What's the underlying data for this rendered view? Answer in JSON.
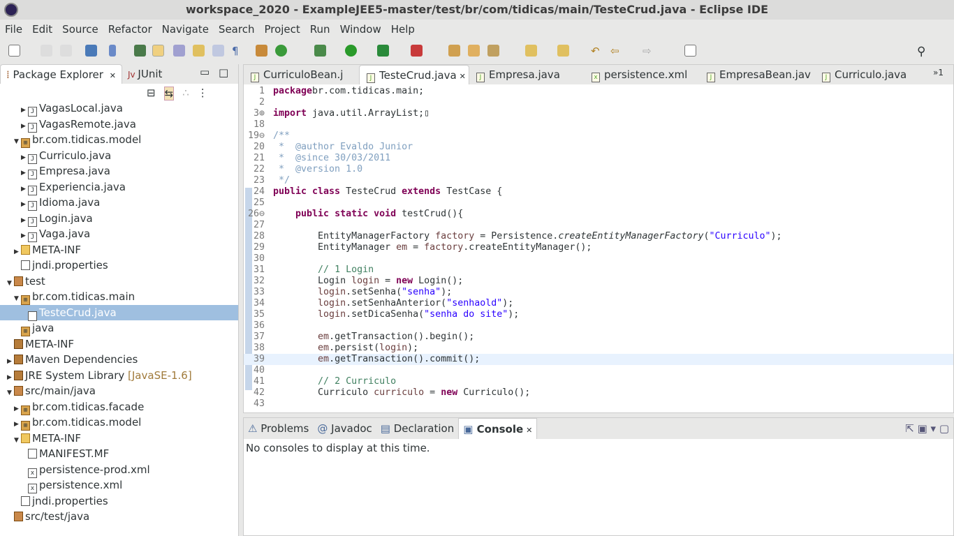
{
  "window": {
    "title": "workspace_2020 - ExampleJEE5-master/test/br/com/tidicas/main/TesteCrud.java - Eclipse IDE"
  },
  "menu": [
    "File",
    "Edit",
    "Source",
    "Refactor",
    "Navigate",
    "Search",
    "Project",
    "Run",
    "Window",
    "Help"
  ],
  "left_panel": {
    "tabs": [
      {
        "label": "Package Explorer",
        "active": true,
        "closable": true
      },
      {
        "label": "JUnit",
        "active": false
      }
    ],
    "tree": [
      {
        "label": "VagasLocal.java",
        "depth": 3,
        "type": "java",
        "arrow": "right"
      },
      {
        "label": "VagasRemote.java",
        "depth": 3,
        "type": "java",
        "arrow": "right"
      },
      {
        "label": "br.com.tidicas.model",
        "depth": 2,
        "type": "pkg",
        "arrow": "down"
      },
      {
        "label": "Curriculo.java",
        "depth": 3,
        "type": "java",
        "arrow": "right"
      },
      {
        "label": "Empresa.java",
        "depth": 3,
        "type": "java",
        "arrow": "right"
      },
      {
        "label": "Experiencia.java",
        "depth": 3,
        "type": "java",
        "arrow": "right"
      },
      {
        "label": "Idioma.java",
        "depth": 3,
        "type": "java",
        "arrow": "right"
      },
      {
        "label": "Login.java",
        "depth": 3,
        "type": "java",
        "arrow": "right"
      },
      {
        "label": "Vaga.java",
        "depth": 3,
        "type": "java",
        "arrow": "right"
      },
      {
        "label": "META-INF",
        "depth": 2,
        "type": "folder",
        "arrow": "right"
      },
      {
        "label": "jndi.properties",
        "depth": 2,
        "type": "file",
        "arrow": ""
      },
      {
        "label": "test",
        "depth": 1,
        "type": "src",
        "arrow": "down"
      },
      {
        "label": "br.com.tidicas.main",
        "depth": 2,
        "type": "pkg",
        "arrow": "down"
      },
      {
        "label": "TesteCrud.java",
        "depth": 3,
        "type": "java",
        "arrow": "",
        "selected": true
      },
      {
        "label": "java",
        "depth": 2,
        "type": "pkg",
        "arrow": ""
      },
      {
        "label": "META-INF",
        "depth": 1,
        "type": "lib",
        "arrow": ""
      },
      {
        "label": "Maven Dependencies",
        "depth": 1,
        "type": "lib",
        "arrow": "right"
      },
      {
        "label": "JRE System Library",
        "depth": 1,
        "type": "lib",
        "arrow": "right",
        "decoration": "[JavaSE-1.6]"
      },
      {
        "label": "src/main/java",
        "depth": 1,
        "type": "src",
        "arrow": "down"
      },
      {
        "label": "br.com.tidicas.facade",
        "depth": 2,
        "type": "pkg",
        "arrow": "right"
      },
      {
        "label": "br.com.tidicas.model",
        "depth": 2,
        "type": "pkg",
        "arrow": "right"
      },
      {
        "label": "META-INF",
        "depth": 2,
        "type": "folder",
        "arrow": "down"
      },
      {
        "label": "MANIFEST.MF",
        "depth": 3,
        "type": "file",
        "arrow": ""
      },
      {
        "label": "persistence-prod.xml",
        "depth": 3,
        "type": "xml",
        "arrow": ""
      },
      {
        "label": "persistence.xml",
        "depth": 3,
        "type": "xml",
        "arrow": ""
      },
      {
        "label": "jndi.properties",
        "depth": 2,
        "type": "file",
        "arrow": ""
      },
      {
        "label": "src/test/java",
        "depth": 1,
        "type": "src",
        "arrow": ""
      }
    ]
  },
  "editor": {
    "tabs": [
      {
        "label": "CurriculoBean.j",
        "active": false
      },
      {
        "label": "TesteCrud.java",
        "active": true,
        "closable": true
      },
      {
        "label": "Empresa.java",
        "active": false
      },
      {
        "label": "persistence.xml",
        "active": false
      },
      {
        "label": "EmpresaBean.jav",
        "active": false
      },
      {
        "label": "Curriculo.java",
        "active": false
      }
    ],
    "overflow": "»1",
    "lines": [
      {
        "n": "1",
        "t": [
          [
            "kw",
            "package"
          ],
          [
            "",
            "br.com.tidicas.main;"
          ]
        ]
      },
      {
        "n": "2",
        "t": []
      },
      {
        "n": "3⊕",
        "t": [
          [
            "kw",
            "import"
          ],
          [
            "",
            " java.util.ArrayList;▯"
          ]
        ]
      },
      {
        "n": "18",
        "t": []
      },
      {
        "n": "19⊖",
        "t": [
          [
            "doc",
            "/**"
          ]
        ]
      },
      {
        "n": "20",
        "t": [
          [
            "doc",
            " *  @author Evaldo Junior"
          ]
        ]
      },
      {
        "n": "21",
        "t": [
          [
            "doc",
            " *  @since 30/03/2011"
          ]
        ]
      },
      {
        "n": "22",
        "t": [
          [
            "doc",
            " *  @version 1.0"
          ]
        ]
      },
      {
        "n": "23",
        "t": [
          [
            "doc",
            " */"
          ]
        ]
      },
      {
        "n": "24",
        "t": [
          [
            "kw",
            "public class"
          ],
          [
            "",
            " TesteCrud "
          ],
          [
            "kw",
            "extends"
          ],
          [
            "",
            " TestCase {"
          ]
        ]
      },
      {
        "n": "25",
        "t": []
      },
      {
        "n": "26⊖",
        "t": [
          [
            "",
            "    "
          ],
          [
            "kw",
            "public static void"
          ],
          [
            "",
            " testCrud(){"
          ]
        ]
      },
      {
        "n": "27",
        "t": []
      },
      {
        "n": "28",
        "t": [
          [
            "",
            "        EntityManagerFactory "
          ],
          [
            "loc",
            "factory"
          ],
          [
            "",
            " = Persistence."
          ],
          [
            "it",
            "createEntityManagerFactory"
          ],
          [
            "",
            "("
          ],
          [
            "str",
            "\"Curriculo\""
          ],
          [
            "",
            ");"
          ]
        ]
      },
      {
        "n": "29",
        "t": [
          [
            "",
            "        EntityManager "
          ],
          [
            "loc",
            "em"
          ],
          [
            "",
            " = "
          ],
          [
            "loc",
            "factory"
          ],
          [
            "",
            ".createEntityManager();"
          ]
        ]
      },
      {
        "n": "30",
        "t": []
      },
      {
        "n": "31",
        "t": [
          [
            "",
            "        "
          ],
          [
            "cm",
            "// 1 Login"
          ]
        ]
      },
      {
        "n": "32",
        "t": [
          [
            "",
            "        Login "
          ],
          [
            "loc",
            "login"
          ],
          [
            "",
            " = "
          ],
          [
            "kw",
            "new"
          ],
          [
            "",
            " Login();"
          ]
        ]
      },
      {
        "n": "33",
        "t": [
          [
            "",
            "        "
          ],
          [
            "loc",
            "login"
          ],
          [
            "",
            ".setSenha("
          ],
          [
            "str",
            "\"senha\""
          ],
          [
            "",
            ");"
          ]
        ]
      },
      {
        "n": "34",
        "t": [
          [
            "",
            "        "
          ],
          [
            "loc",
            "login"
          ],
          [
            "",
            ".setSenhaAnterior("
          ],
          [
            "str",
            "\"senhaold\""
          ],
          [
            "",
            ");"
          ]
        ]
      },
      {
        "n": "35",
        "t": [
          [
            "",
            "        "
          ],
          [
            "loc",
            "login"
          ],
          [
            "",
            ".setDicaSenha("
          ],
          [
            "str",
            "\"senha do site\""
          ],
          [
            "",
            ");"
          ]
        ]
      },
      {
        "n": "36",
        "t": []
      },
      {
        "n": "37",
        "t": [
          [
            "",
            "        "
          ],
          [
            "loc",
            "em"
          ],
          [
            "",
            ".getTransaction().begin();"
          ]
        ]
      },
      {
        "n": "38",
        "t": [
          [
            "",
            "        "
          ],
          [
            "loc",
            "em"
          ],
          [
            "",
            ".persist("
          ],
          [
            "loc",
            "login"
          ],
          [
            "",
            ");"
          ]
        ]
      },
      {
        "n": "39",
        "t": [
          [
            "",
            "        "
          ],
          [
            "loc",
            "em"
          ],
          [
            "",
            ".getTransaction().commit();"
          ]
        ],
        "current": true
      },
      {
        "n": "40",
        "t": []
      },
      {
        "n": "41",
        "t": [
          [
            "",
            "        "
          ],
          [
            "cm",
            "// 2 Curriculo"
          ]
        ]
      },
      {
        "n": "42",
        "t": [
          [
            "",
            "        Curriculo "
          ],
          [
            "loc",
            "curriculo"
          ],
          [
            "",
            " = "
          ],
          [
            "kw",
            "new"
          ],
          [
            "",
            " Curriculo();"
          ]
        ]
      },
      {
        "n": "43",
        "t": []
      }
    ]
  },
  "bottom_panel": {
    "tabs": [
      {
        "label": "Problems"
      },
      {
        "label": "Javadoc"
      },
      {
        "label": "Declaration"
      },
      {
        "label": "Console",
        "active": true,
        "closable": true
      }
    ],
    "message": "No consoles to display at this time."
  },
  "colors": {
    "keyword": "#7f0055",
    "string": "#2a00ff",
    "comment": "#3f7f5f",
    "javadoc": "#7f9fbf",
    "selection": "#9fbfe0"
  }
}
